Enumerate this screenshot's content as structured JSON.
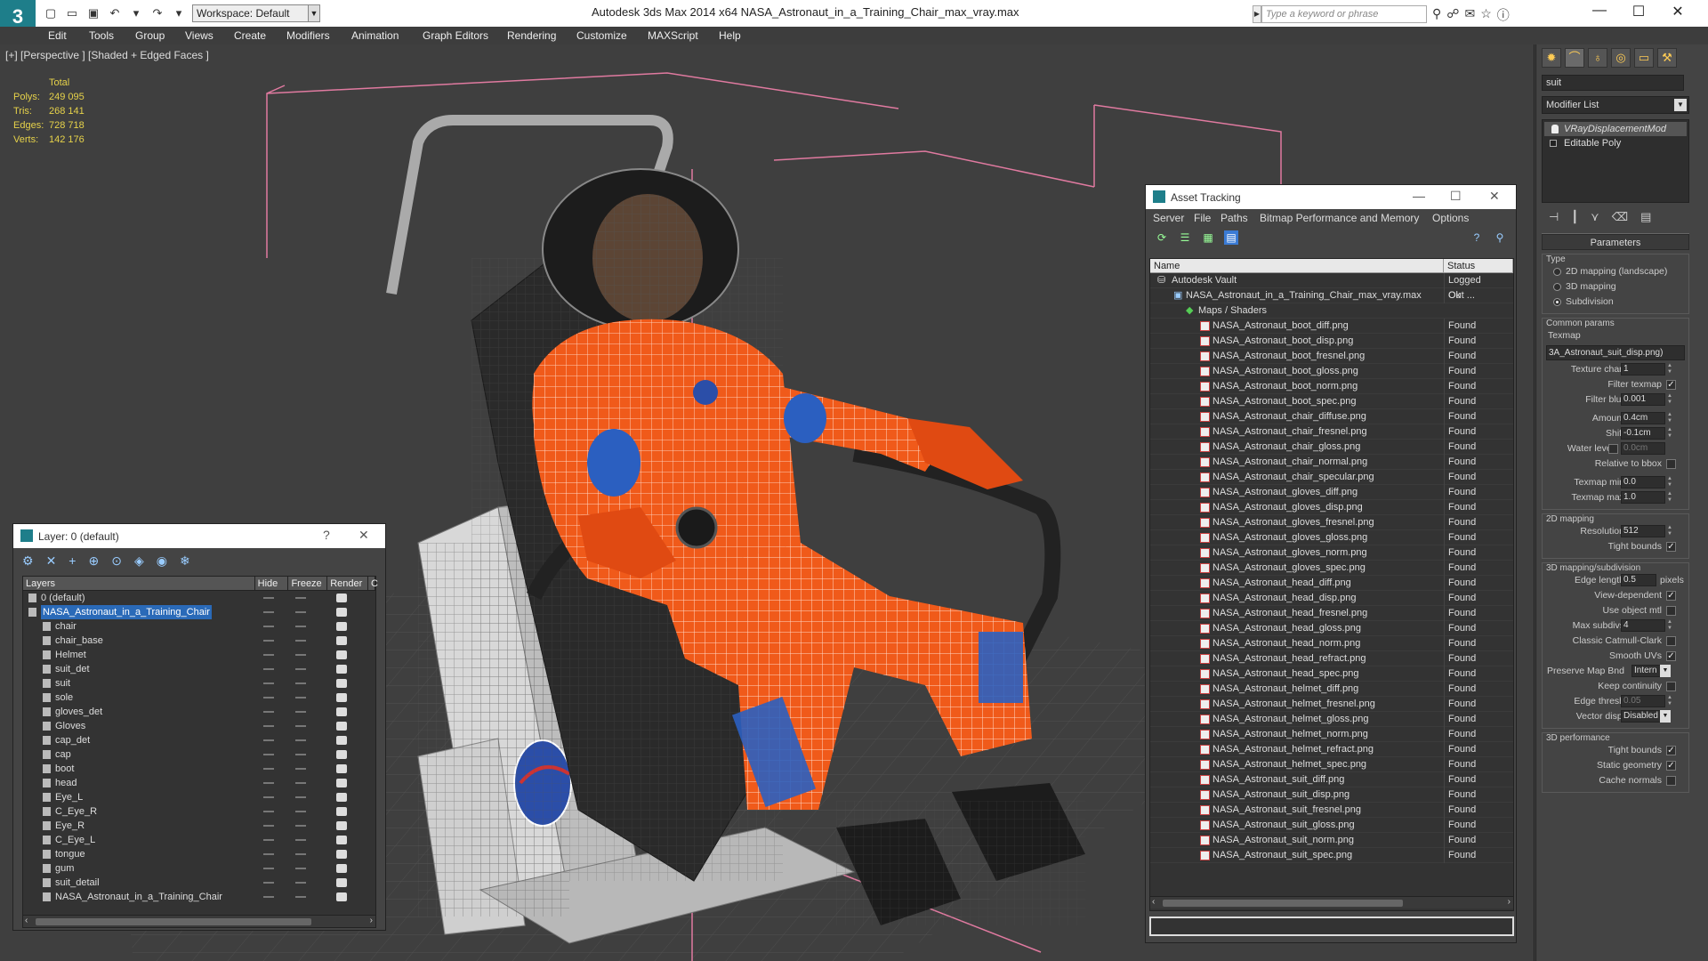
{
  "app": {
    "logo": "3",
    "window_title": "Autodesk 3ds Max  2014 x64      NASA_Astronaut_in_a_Training_Chair_max_vray.max",
    "workspace_label": "Workspace: Default",
    "search_placeholder": "Type a keyword or phrase",
    "brand_color": "#1e7e8a"
  },
  "menu": [
    "Edit",
    "Tools",
    "Group",
    "Views",
    "Create",
    "Modifiers",
    "Animation",
    "Graph Editors",
    "Rendering",
    "Customize",
    "MAXScript",
    "Help"
  ],
  "viewport": {
    "label": "[+] [Perspective ] [Shaded + Edged Faces ]",
    "stats_header": "Total",
    "stats": [
      {
        "key": "Polys:",
        "value": "249 095"
      },
      {
        "key": "Tris:",
        "value": "268 141"
      },
      {
        "key": "Edges:",
        "value": "728 718"
      },
      {
        "key": "Verts:",
        "value": "142 176"
      }
    ],
    "stats_color": "#e6d24a"
  },
  "command_panel": {
    "object_name": "suit",
    "modifier_list": "Modifier List",
    "stack": [
      "VRayDisplacementMod",
      "Editable Poly"
    ],
    "rollout_title": "Parameters",
    "type_group": "Type",
    "type_options": [
      "2D mapping (landscape)",
      "3D mapping",
      "Subdivision"
    ],
    "common_group": "Common params",
    "texmap_label": "Texmap",
    "texmap_value": "3A_Astronaut_suit_disp.png)",
    "texture_chan_label": "Texture chan",
    "texture_chan": "1",
    "filter_texmap": "Filter texmap",
    "filter_blur_label": "Filter blur",
    "filter_blur": "0.001",
    "amount_label": "Amount",
    "amount": "0.4cm",
    "shift_label": "Shift",
    "shift": "-0.1cm",
    "water_level_label": "Water level",
    "water_level": "0.0cm",
    "relative_bbox": "Relative to bbox",
    "texmap_min_label": "Texmap min",
    "texmap_min": "0.0",
    "texmap_max_label": "Texmap max",
    "texmap_max": "1.0",
    "mapping2d_group": "2D mapping",
    "resolution_label": "Resolution",
    "resolution": "512",
    "tight_bounds": "Tight bounds",
    "mapping3d_group": "3D mapping/subdivision",
    "edge_length_label": "Edge length",
    "edge_length": "0.5",
    "pixels": "pixels",
    "view_dependent": "View-dependent",
    "use_object_mtl": "Use object mtl",
    "max_subdivs_label": "Max subdivs",
    "max_subdivs": "4",
    "catmull": "Classic Catmull-Clark",
    "smooth_uvs": "Smooth UVs",
    "preserve_label": "Preserve Map Bnd",
    "preserve": "Intern",
    "keep_continuity": "Keep continuity",
    "edge_thresh_label": "Edge thresh",
    "edge_thresh": "0.05",
    "vector_disp_label": "Vector displ",
    "vector_disp": "Disabled",
    "perf_group": "3D performance",
    "perf_tight": "Tight bounds",
    "static_geo": "Static geometry",
    "cache_normals": "Cache normals"
  },
  "layer_dialog": {
    "title": "Layer: 0 (default)",
    "help": "?",
    "columns": [
      "Layers",
      "Hide",
      "Freeze",
      "Render",
      "C"
    ],
    "rows": [
      {
        "name": "0 (default)",
        "level": 0
      },
      {
        "name": "NASA_Astronaut_in_a_Training_Chair",
        "level": 0,
        "selected": true
      },
      {
        "name": "chair",
        "level": 1
      },
      {
        "name": "chair_base",
        "level": 1
      },
      {
        "name": "Helmet",
        "level": 1
      },
      {
        "name": "suit_det",
        "level": 1
      },
      {
        "name": "suit",
        "level": 1
      },
      {
        "name": "sole",
        "level": 1
      },
      {
        "name": "gloves_det",
        "level": 1
      },
      {
        "name": "Gloves",
        "level": 1
      },
      {
        "name": "cap_det",
        "level": 1
      },
      {
        "name": "cap",
        "level": 1
      },
      {
        "name": "boot",
        "level": 1
      },
      {
        "name": "head",
        "level": 1
      },
      {
        "name": "Eye_L",
        "level": 1
      },
      {
        "name": "C_Eye_R",
        "level": 1
      },
      {
        "name": "Eye_R",
        "level": 1
      },
      {
        "name": "C_Eye_L",
        "level": 1
      },
      {
        "name": "tongue",
        "level": 1
      },
      {
        "name": "gum",
        "level": 1
      },
      {
        "name": "suit_detail",
        "level": 1
      },
      {
        "name": "NASA_Astronaut_in_a_Training_Chair",
        "level": 1
      }
    ]
  },
  "asset_dialog": {
    "title": "Asset Tracking",
    "menu": [
      "Server",
      "File",
      "Paths",
      "Bitmap Performance and Memory",
      "Options"
    ],
    "columns": [
      "Name",
      "Status"
    ],
    "vault": {
      "name": "Autodesk Vault",
      "status": "Logged Out ..."
    },
    "file": {
      "name": "NASA_Astronaut_in_a_Training_Chair_max_vray.max",
      "status": "Ok"
    },
    "folder": "Maps / Shaders",
    "found_label": "Found",
    "maps": [
      "NASA_Astronaut_boot_diff.png",
      "NASA_Astronaut_boot_disp.png",
      "NASA_Astronaut_boot_fresnel.png",
      "NASA_Astronaut_boot_gloss.png",
      "NASA_Astronaut_boot_norm.png",
      "NASA_Astronaut_boot_spec.png",
      "NASA_Astronaut_chair_diffuse.png",
      "NASA_Astronaut_chair_fresnel.png",
      "NASA_Astronaut_chair_gloss.png",
      "NASA_Astronaut_chair_normal.png",
      "NASA_Astronaut_chair_specular.png",
      "NASA_Astronaut_gloves_diff.png",
      "NASA_Astronaut_gloves_disp.png",
      "NASA_Astronaut_gloves_fresnel.png",
      "NASA_Astronaut_gloves_gloss.png",
      "NASA_Astronaut_gloves_norm.png",
      "NASA_Astronaut_gloves_spec.png",
      "NASA_Astronaut_head_diff.png",
      "NASA_Astronaut_head_disp.png",
      "NASA_Astronaut_head_fresnel.png",
      "NASA_Astronaut_head_gloss.png",
      "NASA_Astronaut_head_norm.png",
      "NASA_Astronaut_head_refract.png",
      "NASA_Astronaut_head_spec.png",
      "NASA_Astronaut_helmet_diff.png",
      "NASA_Astronaut_helmet_fresnel.png",
      "NASA_Astronaut_helmet_gloss.png",
      "NASA_Astronaut_helmet_norm.png",
      "NASA_Astronaut_helmet_refract.png",
      "NASA_Astronaut_helmet_spec.png",
      "NASA_Astronaut_suit_diff.png",
      "NASA_Astronaut_suit_disp.png",
      "NASA_Astronaut_suit_fresnel.png",
      "NASA_Astronaut_suit_gloss.png",
      "NASA_Astronaut_suit_norm.png",
      "NASA_Astronaut_suit_spec.png"
    ]
  }
}
